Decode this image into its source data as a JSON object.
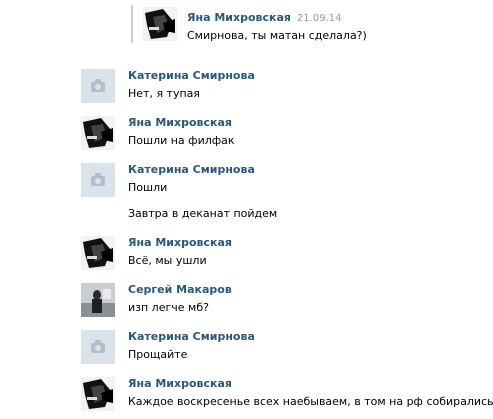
{
  "quoted": {
    "author": "Яна Михровская",
    "date": "21.09.14",
    "text": "Смирнова, ты матан сделала?)"
  },
  "messages": [
    {
      "author": "Катерина Смирнова",
      "avatar": "camera-placeholder",
      "texts": [
        "Нет, я тупая"
      ]
    },
    {
      "author": "Яна Михровская",
      "avatar": "photo-yana",
      "texts": [
        "Пошли на филфак"
      ]
    },
    {
      "author": "Катерина Смирнова",
      "avatar": "camera-placeholder",
      "texts": [
        "Пошли",
        "Завтра в деканат пойдем"
      ]
    },
    {
      "author": "Яна Михровская",
      "avatar": "photo-yana",
      "texts": [
        "Всё, мы ушли"
      ]
    },
    {
      "author": "Сергей Макаров",
      "avatar": "photo-sergey",
      "texts": [
        "изп легче мб?"
      ]
    },
    {
      "author": "Катерина Смирнова",
      "avatar": "camera-placeholder",
      "texts": [
        "Прощайте"
      ]
    },
    {
      "author": "Яна Михровская",
      "avatar": "photo-yana",
      "texts": [
        "Каждое воскресенье всех наебываем, в том на рф собирались"
      ]
    }
  ]
}
